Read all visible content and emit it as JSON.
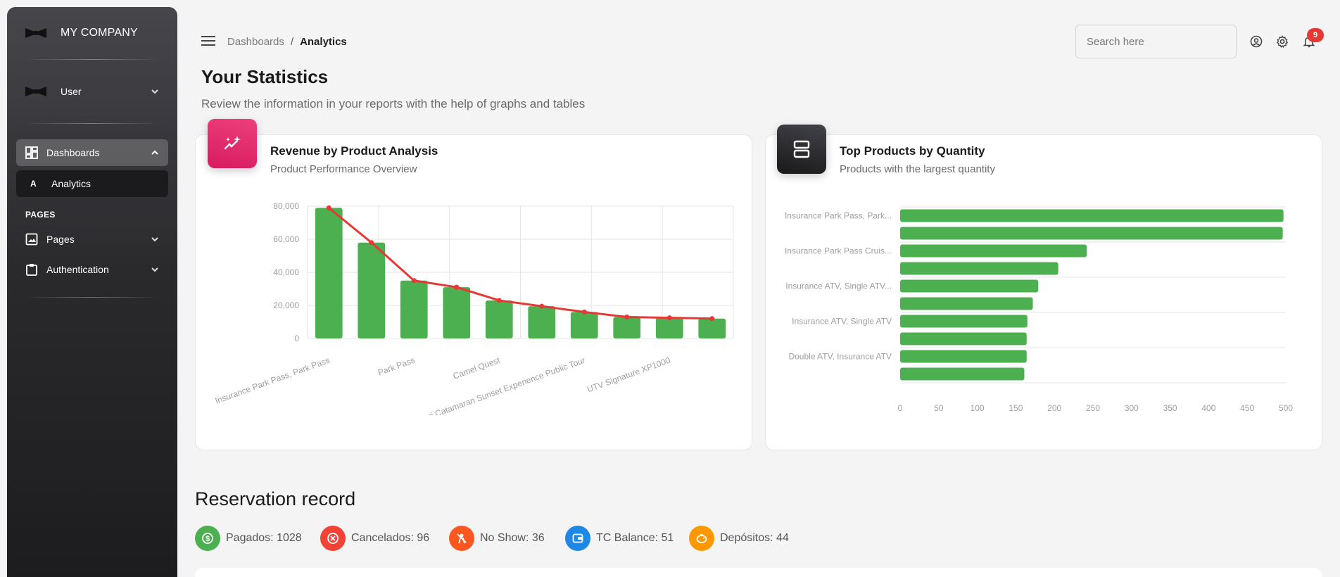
{
  "sidebar": {
    "brand": "MY COMPANY",
    "user_label": "User",
    "dashboards_label": "Dashboards",
    "analytics_letter": "A",
    "analytics_label": "Analytics",
    "pages_section": "PAGES",
    "pages_label": "Pages",
    "authentication_label": "Authentication"
  },
  "topbar": {
    "breadcrumb_parent": "Dashboards",
    "breadcrumb_separator": "/",
    "breadcrumb_current": "Analytics",
    "search_placeholder": "Search here",
    "notification_count": "9"
  },
  "header": {
    "title": "Your Statistics",
    "subtitle": "Review the information in your reports with the help of graphs and tables"
  },
  "revenue_card": {
    "title": "Revenue by Product Analysis",
    "subtitle": "Product Performance Overview",
    "icon": "sparkles-chart-icon",
    "accent": "#e91e63"
  },
  "quantity_card": {
    "title": "Top Products by Quantity",
    "subtitle": "Products with the largest quantity",
    "icon": "stack-icon",
    "accent": "#343434"
  },
  "chart_data": [
    {
      "type": "bar",
      "title": "Revenue by Product Analysis",
      "series_color": "#4caf50",
      "line_color": "#e53935",
      "ylim": [
        0,
        80000
      ],
      "yticks": [
        "0",
        "20,000",
        "40,000",
        "60,000",
        "80,000"
      ],
      "ytick_values": [
        0,
        20000,
        40000,
        60000,
        80000
      ],
      "category_labels": [
        "Insurance Park Pass, Park Pass",
        "Park Pass",
        "Camel Quest",
        "Satori Catamaran Sunset Experience Public Tour",
        "UTV Signature XP1000"
      ],
      "values": [
        79000,
        58000,
        35000,
        31000,
        23000,
        19500,
        16000,
        13000,
        12500,
        12000
      ],
      "trend": [
        79000,
        58000,
        35000,
        31000,
        23000,
        19500,
        16000,
        13000,
        12500,
        12000
      ],
      "grid": true
    },
    {
      "type": "bar",
      "orientation": "horizontal",
      "title": "Top Products by Quantity",
      "series_color": "#4caf50",
      "xlim": [
        0,
        500
      ],
      "xticks": [
        "0",
        "50",
        "100",
        "150",
        "200",
        "250",
        "300",
        "350",
        "400",
        "450",
        "500"
      ],
      "category_labels": [
        "Insurance Park Pass, Park...",
        "Insurance Park Pass Cruis...",
        "Insurance ATV, Single ATV...",
        "Insurance ATV, Single ATV",
        "Double ATV, Insurance ATV"
      ],
      "values": [
        497,
        496,
        242,
        205,
        179,
        172,
        165,
        164,
        164,
        161
      ],
      "grid": true
    }
  ],
  "reservation": {
    "title": "Reservation record",
    "stats": [
      {
        "label": "Pagados: 1028",
        "color": "#4caf50",
        "icon": "dollar-icon"
      },
      {
        "label": "Cancelados: 96",
        "color": "#f44336",
        "icon": "cancel-icon"
      },
      {
        "label": "No Show: 36",
        "color": "#ff5722",
        "icon": "no-show-icon"
      },
      {
        "label": "TC Balance: 51",
        "color": "#1e88e5",
        "icon": "wallet-icon"
      },
      {
        "label": "Depósitos: 44",
        "color": "#ff9800",
        "icon": "piggy-bank-icon"
      }
    ]
  }
}
